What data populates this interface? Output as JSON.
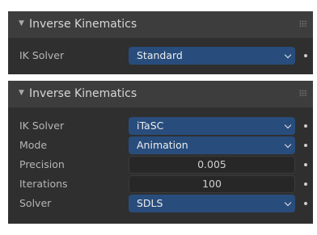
{
  "panel1": {
    "header": {
      "collapse_glyph": "▼",
      "title": "Inverse Kinematics"
    },
    "ik_solver": {
      "label": "IK Solver",
      "value": "Standard"
    }
  },
  "panel2": {
    "header": {
      "collapse_glyph": "▼",
      "title": "Inverse Kinematics"
    },
    "ik_solver": {
      "label": "IK Solver",
      "value": "iTaSC"
    },
    "mode": {
      "label": "Mode",
      "value": "Animation"
    },
    "precision": {
      "label": "Precision",
      "value": "0.005"
    },
    "iterations": {
      "label": "Iterations",
      "value": "100"
    },
    "solver": {
      "label": "Solver",
      "value": "SDLS"
    }
  },
  "colors": {
    "panel_bg": "#2f2f2f",
    "header_bg": "#3d3d3d",
    "select_bg": "#284d7d",
    "number_bg": "#272727"
  }
}
